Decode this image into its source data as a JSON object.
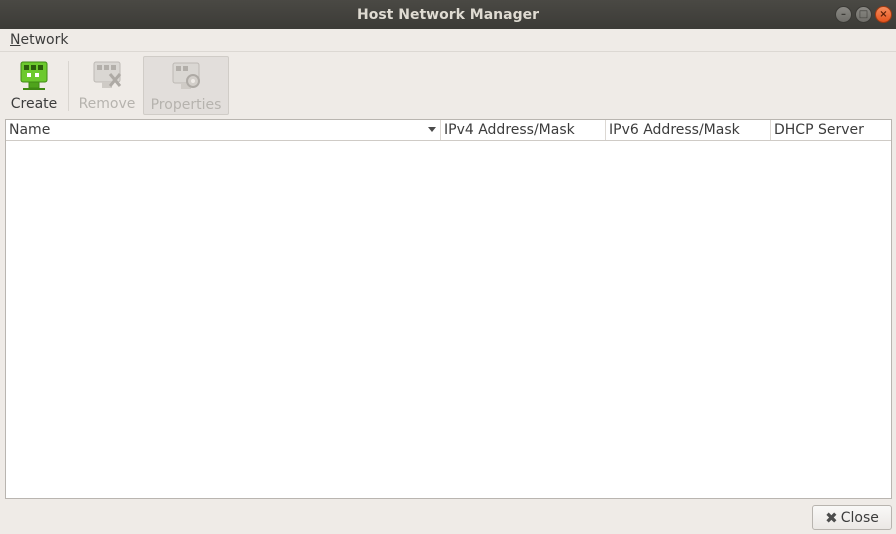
{
  "window": {
    "title": "Host Network Manager",
    "controls": {
      "minimize_icon": "minimize-icon",
      "maximize_icon": "maximize-icon",
      "close_icon": "close-icon"
    }
  },
  "menubar": {
    "items": [
      {
        "label_underlined": "N",
        "label_rest": "etwork"
      }
    ]
  },
  "toolbar": {
    "create": {
      "label": "Create",
      "icon": "network-create-icon",
      "enabled": true
    },
    "remove": {
      "label": "Remove",
      "icon": "network-remove-icon",
      "enabled": false
    },
    "properties": {
      "label": "Properties",
      "icon": "network-properties-icon",
      "enabled": false,
      "checked": true
    }
  },
  "table": {
    "columns": [
      {
        "label": "Name",
        "sorted": true
      },
      {
        "label": "IPv4 Address/Mask"
      },
      {
        "label": "IPv6 Address/Mask"
      },
      {
        "label": "DHCP Server"
      }
    ],
    "rows": []
  },
  "footer": {
    "close_label": "Close",
    "close_icon": "x-icon"
  },
  "colors": {
    "titlebar": "#3c3b37",
    "window_bg": "#efebe7",
    "close_orange": "#e5541e",
    "create_green": "#6cc92e"
  }
}
